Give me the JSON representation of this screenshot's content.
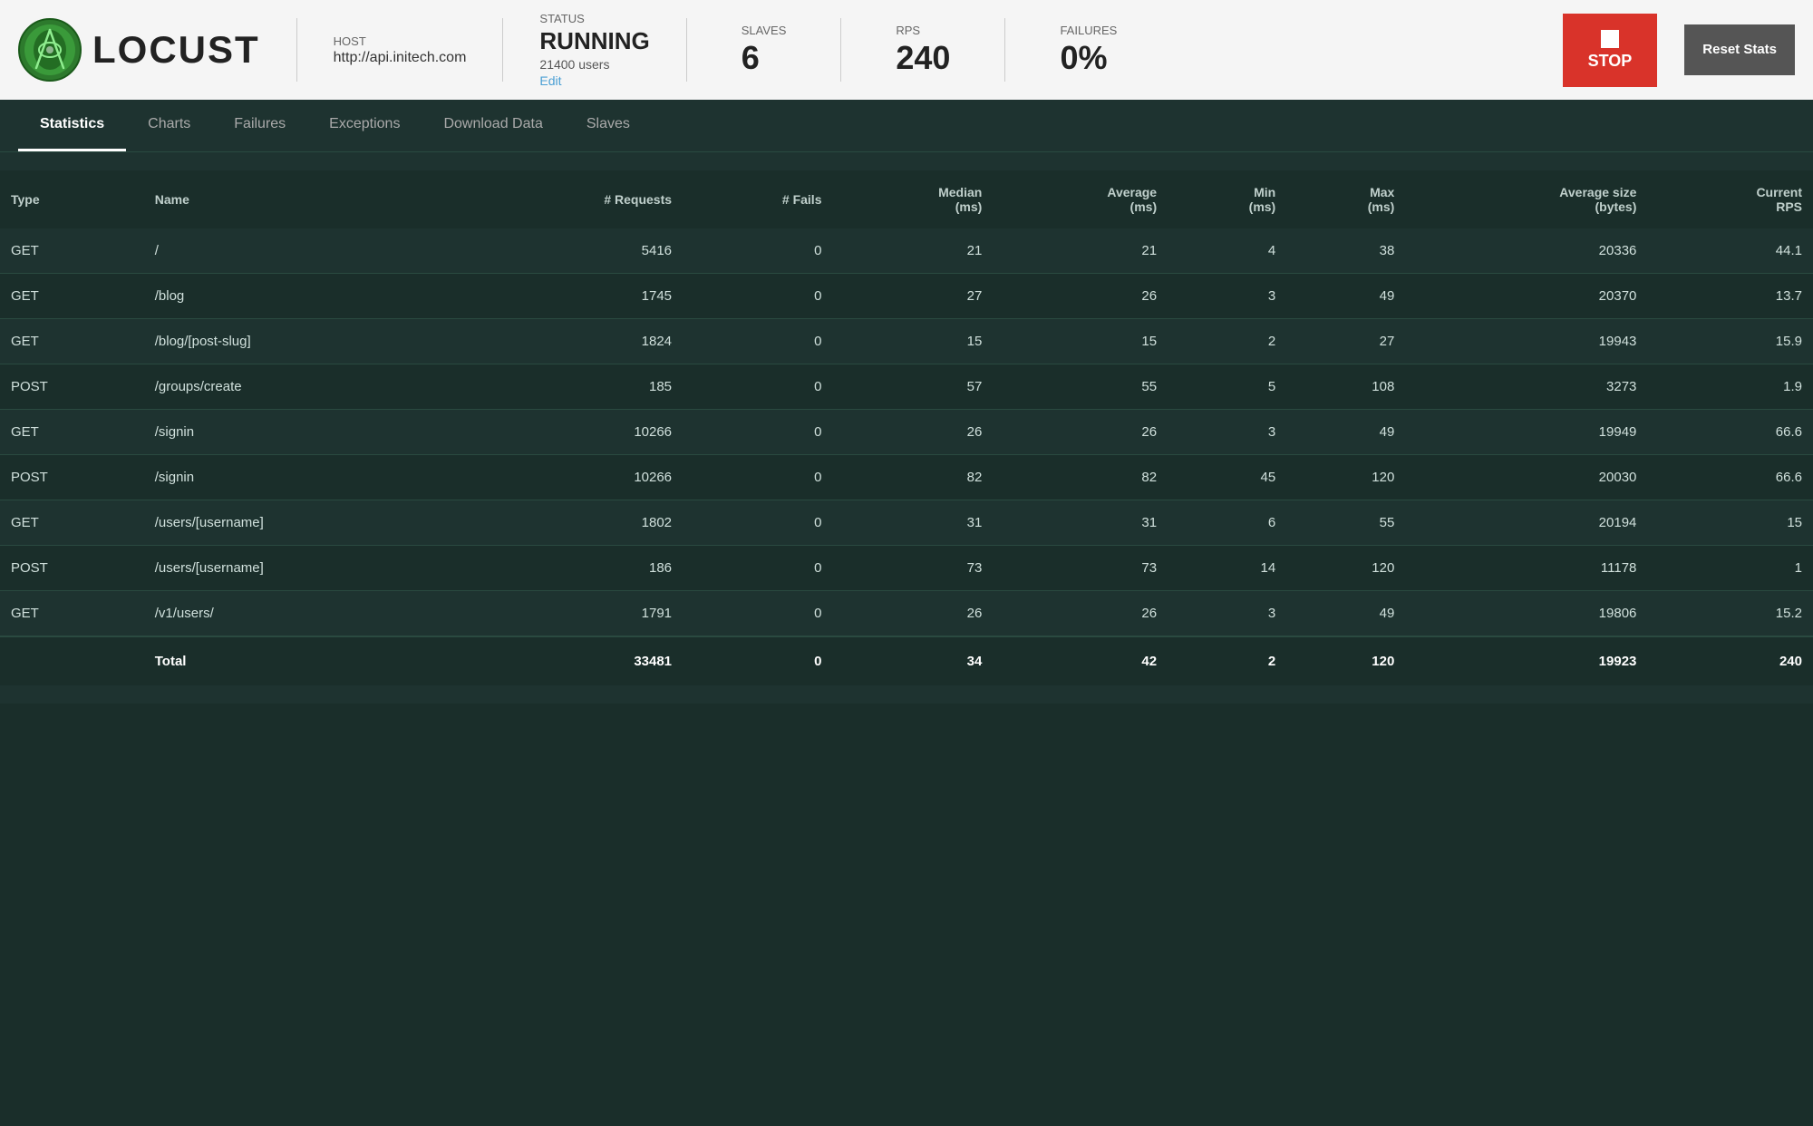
{
  "header": {
    "host_label": "HOST",
    "host_value": "http://api.initech.com",
    "status_label": "STATUS",
    "status_value": "RUNNING",
    "status_users": "21400 users",
    "status_edit": "Edit",
    "slaves_label": "SLAVES",
    "slaves_value": "6",
    "rps_label": "RPS",
    "rps_value": "240",
    "failures_label": "FAILURES",
    "failures_value": "0%",
    "stop_label": "STOP",
    "reset_label": "Reset Stats"
  },
  "nav": {
    "tabs": [
      {
        "id": "statistics",
        "label": "Statistics",
        "active": true
      },
      {
        "id": "charts",
        "label": "Charts",
        "active": false
      },
      {
        "id": "failures",
        "label": "Failures",
        "active": false
      },
      {
        "id": "exceptions",
        "label": "Exceptions",
        "active": false
      },
      {
        "id": "download-data",
        "label": "Download Data",
        "active": false
      },
      {
        "id": "slaves",
        "label": "Slaves",
        "active": false
      }
    ]
  },
  "table": {
    "columns": [
      {
        "id": "type",
        "label": "Type"
      },
      {
        "id": "name",
        "label": "Name"
      },
      {
        "id": "requests",
        "label": "# Requests"
      },
      {
        "id": "fails",
        "label": "# Fails"
      },
      {
        "id": "median",
        "label": "Median\n(ms)"
      },
      {
        "id": "average",
        "label": "Average\n(ms)"
      },
      {
        "id": "min",
        "label": "Min\n(ms)"
      },
      {
        "id": "max",
        "label": "Max\n(ms)"
      },
      {
        "id": "avg_size",
        "label": "Average size\n(bytes)"
      },
      {
        "id": "current_rps",
        "label": "Current\nRPS"
      }
    ],
    "rows": [
      {
        "type": "GET",
        "name": "/",
        "requests": "5416",
        "fails": "0",
        "median": "21",
        "average": "21",
        "min": "4",
        "max": "38",
        "avg_size": "20336",
        "current_rps": "44.1"
      },
      {
        "type": "GET",
        "name": "/blog",
        "requests": "1745",
        "fails": "0",
        "median": "27",
        "average": "26",
        "min": "3",
        "max": "49",
        "avg_size": "20370",
        "current_rps": "13.7"
      },
      {
        "type": "GET",
        "name": "/blog/[post-slug]",
        "requests": "1824",
        "fails": "0",
        "median": "15",
        "average": "15",
        "min": "2",
        "max": "27",
        "avg_size": "19943",
        "current_rps": "15.9"
      },
      {
        "type": "POST",
        "name": "/groups/create",
        "requests": "185",
        "fails": "0",
        "median": "57",
        "average": "55",
        "min": "5",
        "max": "108",
        "avg_size": "3273",
        "current_rps": "1.9"
      },
      {
        "type": "GET",
        "name": "/signin",
        "requests": "10266",
        "fails": "0",
        "median": "26",
        "average": "26",
        "min": "3",
        "max": "49",
        "avg_size": "19949",
        "current_rps": "66.6"
      },
      {
        "type": "POST",
        "name": "/signin",
        "requests": "10266",
        "fails": "0",
        "median": "82",
        "average": "82",
        "min": "45",
        "max": "120",
        "avg_size": "20030",
        "current_rps": "66.6"
      },
      {
        "type": "GET",
        "name": "/users/[username]",
        "requests": "1802",
        "fails": "0",
        "median": "31",
        "average": "31",
        "min": "6",
        "max": "55",
        "avg_size": "20194",
        "current_rps": "15"
      },
      {
        "type": "POST",
        "name": "/users/[username]",
        "requests": "186",
        "fails": "0",
        "median": "73",
        "average": "73",
        "min": "14",
        "max": "120",
        "avg_size": "11178",
        "current_rps": "1"
      },
      {
        "type": "GET",
        "name": "/v1/users/",
        "requests": "1791",
        "fails": "0",
        "median": "26",
        "average": "26",
        "min": "3",
        "max": "49",
        "avg_size": "19806",
        "current_rps": "15.2"
      }
    ],
    "totals": {
      "label": "Total",
      "requests": "33481",
      "fails": "0",
      "median": "34",
      "average": "42",
      "min": "2",
      "max": "120",
      "avg_size": "19923",
      "current_rps": "240"
    }
  }
}
